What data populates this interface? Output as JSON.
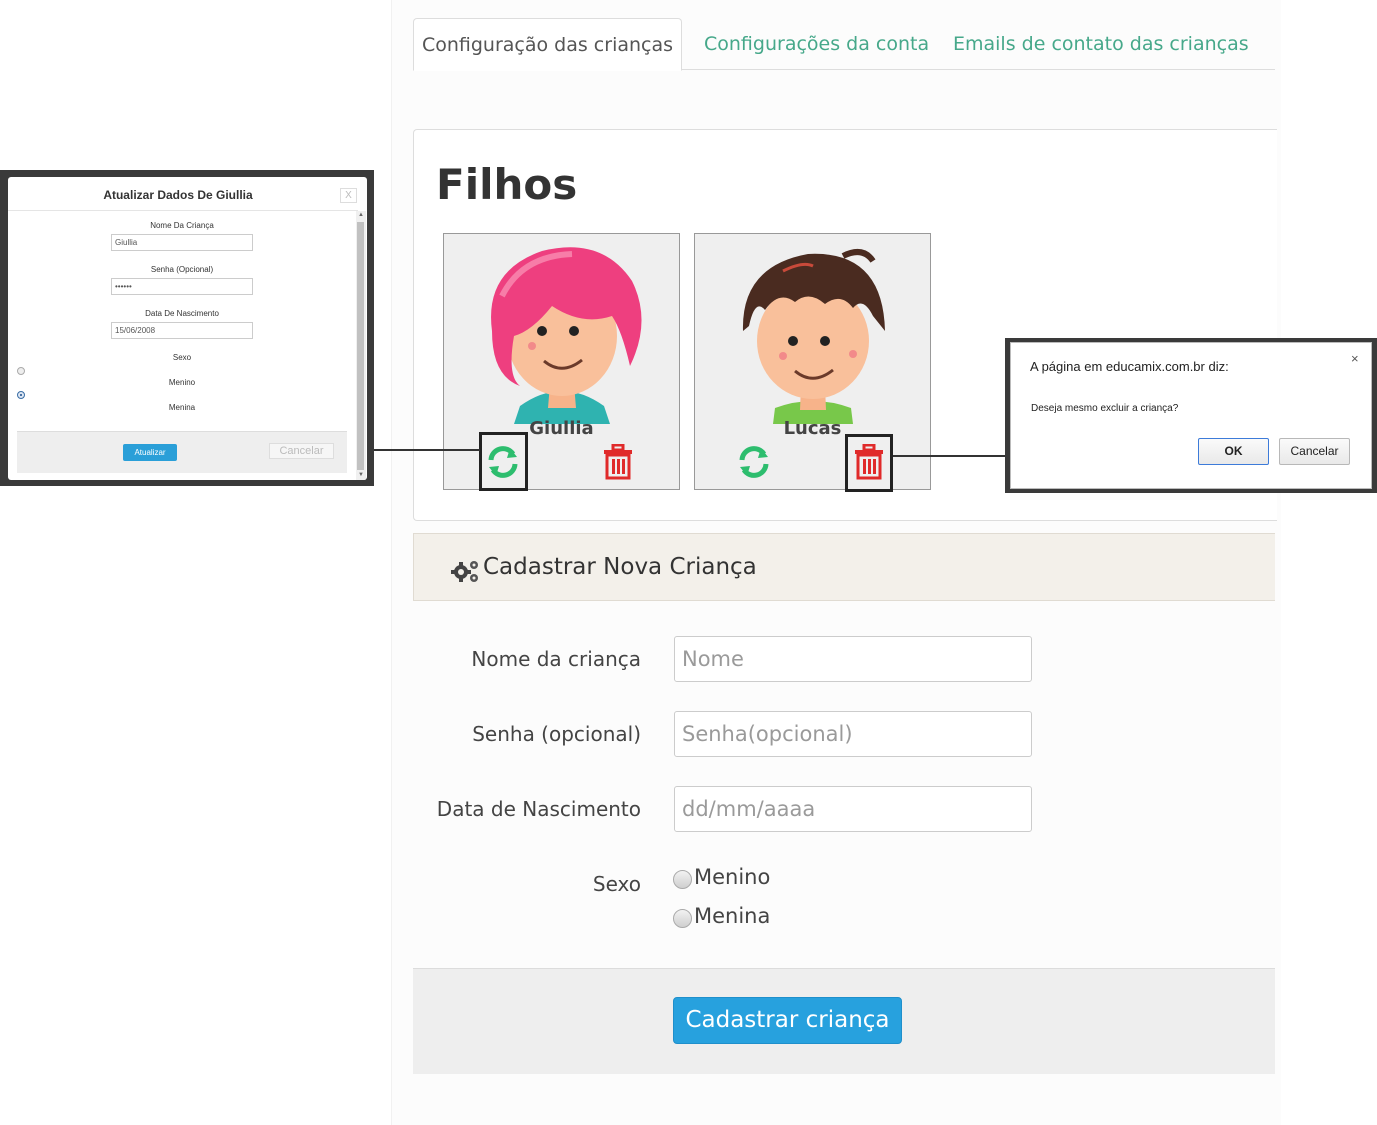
{
  "tabs": [
    {
      "label": "Configuração das crianças",
      "active": true
    },
    {
      "label": "Configurações da conta",
      "active": false
    },
    {
      "label": "Emails de contato das crianças",
      "active": false
    }
  ],
  "filhos": {
    "title": "Filhos",
    "children": [
      {
        "name": "Giullia",
        "avatar": "girl-avatar"
      },
      {
        "name": "Lucas",
        "avatar": "boy-avatar"
      }
    ]
  },
  "cadastro": {
    "header": "Cadastrar Nova Criança",
    "fields": {
      "nome_label": "Nome da criança",
      "nome_placeholder": "Nome",
      "senha_label": "Senha (opcional)",
      "senha_placeholder": "Senha(opcional)",
      "nascimento_label": "Data de Nascimento",
      "nascimento_placeholder": "dd/mm/aaaa",
      "sexo_label": "Sexo",
      "sexo_options": [
        "Menino",
        "Menina"
      ]
    },
    "submit_label": "Cadastrar criança"
  },
  "update_modal": {
    "title": "Atualizar Dados De Giullia",
    "close": "X",
    "nome_label": "Nome Da Criança",
    "nome_value": "Giullia",
    "senha_label": "Senha (Opcional)",
    "senha_value": "••••••",
    "nascimento_label": "Data De Nascimento",
    "nascimento_value": "15/06/2008",
    "sexo_label": "Sexo",
    "sexo_options": [
      "Menino",
      "Menina"
    ],
    "sexo_selected": "Menina",
    "submit_label": "Atualizar",
    "cancel_label": "Cancelar"
  },
  "confirm_dialog": {
    "title": "A página em educamix.com.br diz:",
    "close": "×",
    "message": "Deseja mesmo excluir a criança?",
    "ok_label": "OK",
    "cancel_label": "Cancelar"
  },
  "colors": {
    "tab_link": "#46a88a",
    "primary": "#27a1de",
    "refresh_icon": "#2dbd6e",
    "trash_icon": "#e02a2a"
  }
}
